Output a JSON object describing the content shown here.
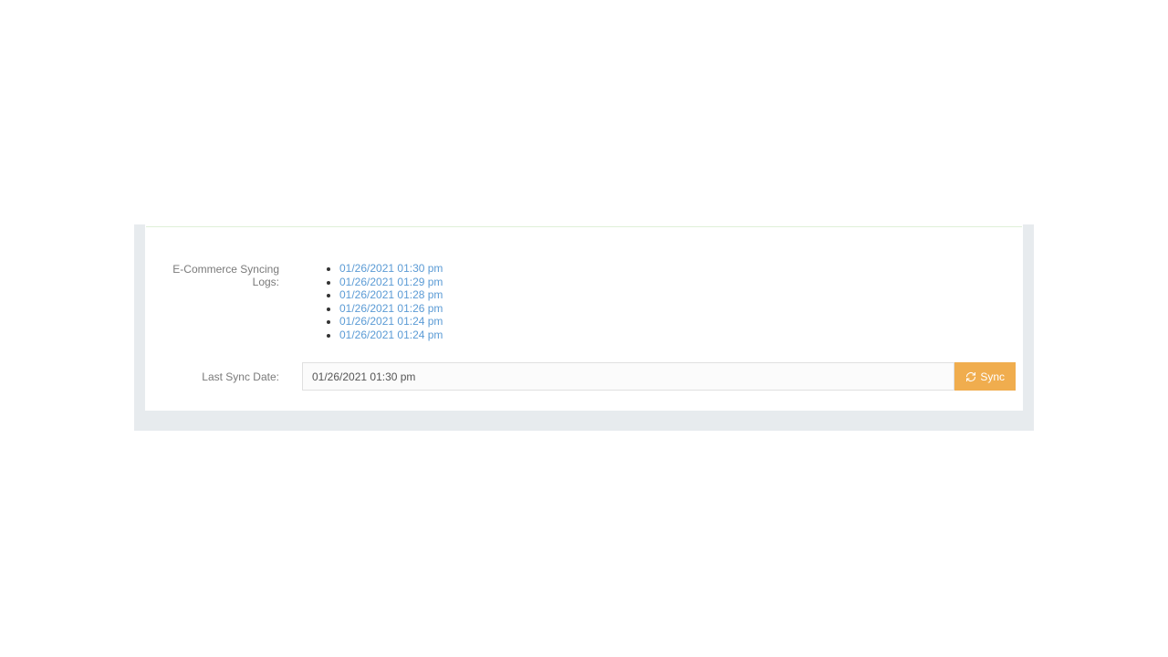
{
  "labels": {
    "syncing_logs": "E-Commerce Syncing Logs:",
    "last_sync_date": "Last Sync Date:"
  },
  "logs": [
    {
      "label": "01/26/2021 01:30 pm"
    },
    {
      "label": "01/26/2021 01:29 pm"
    },
    {
      "label": "01/26/2021 01:28 pm"
    },
    {
      "label": "01/26/2021 01:26 pm"
    },
    {
      "label": "01/26/2021 01:24 pm"
    },
    {
      "label": "01/26/2021 01:24 pm"
    }
  ],
  "last_sync": {
    "value": "01/26/2021 01:30 pm"
  },
  "buttons": {
    "sync": "Sync"
  }
}
